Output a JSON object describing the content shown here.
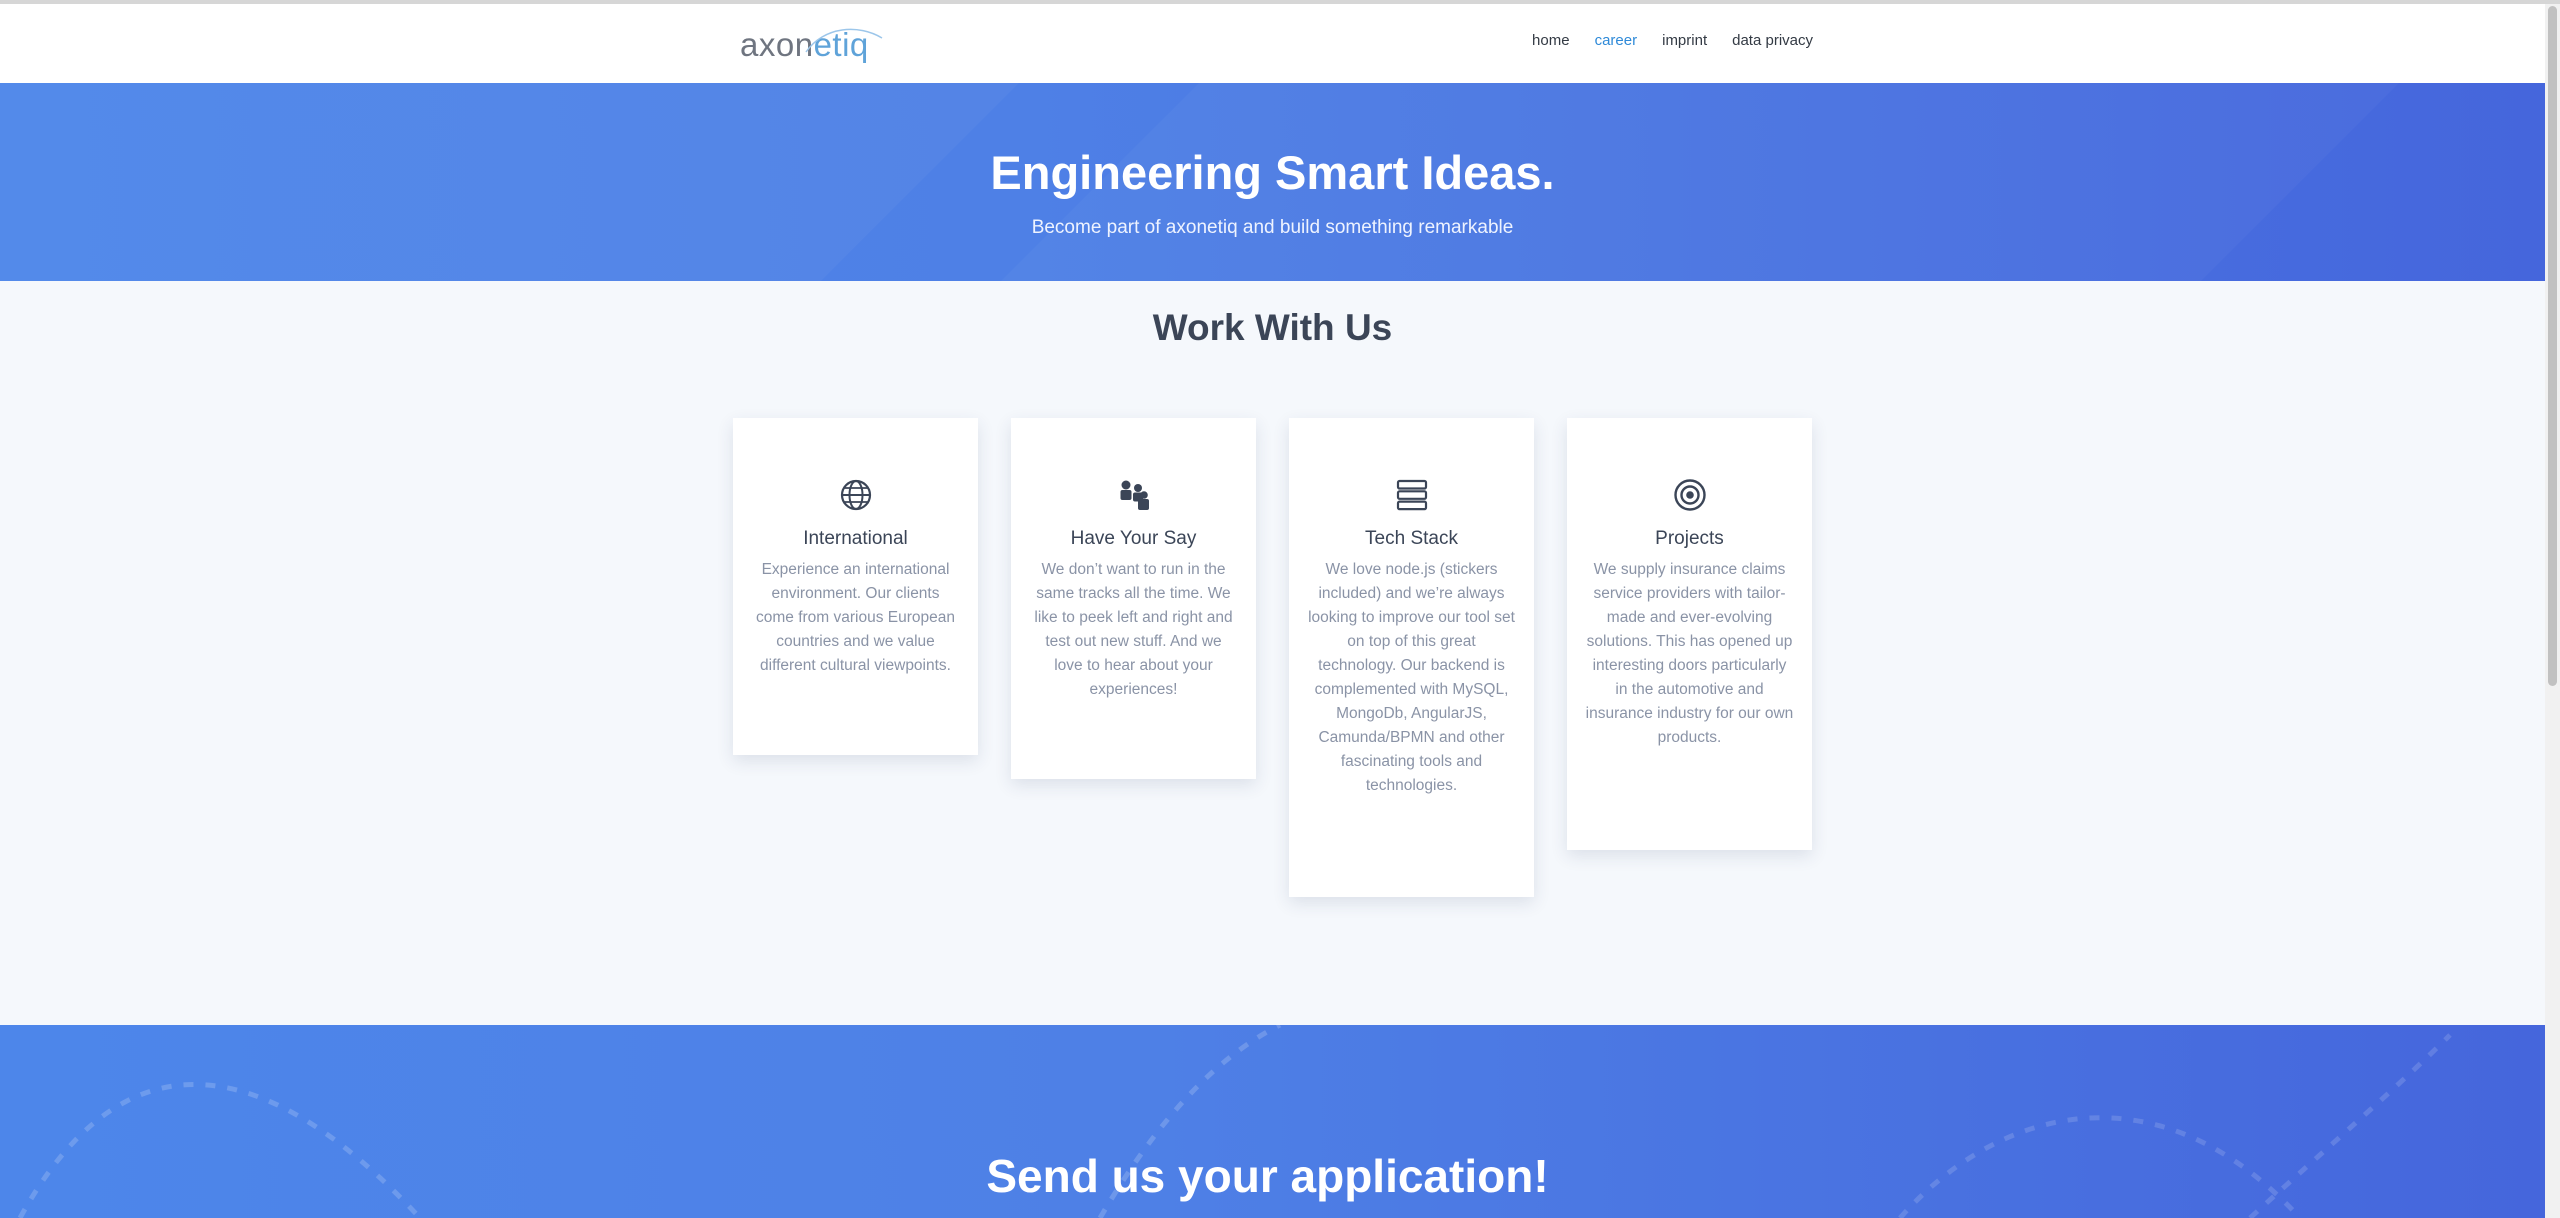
{
  "logo": {
    "part1": "axon",
    "part2": "etiq"
  },
  "nav": {
    "items": [
      {
        "label": "home",
        "active": false
      },
      {
        "label": "career",
        "active": true
      },
      {
        "label": "imprint",
        "active": false
      },
      {
        "label": "data privacy",
        "active": false
      }
    ]
  },
  "hero": {
    "title": "Engineering Smart Ideas.",
    "subtitle": "Become part of axonetiq and build something remarkable"
  },
  "section": {
    "title": "Work With Us"
  },
  "cards": [
    {
      "icon": "globe-icon",
      "title": "International",
      "text": "Experience an international environment. Our clients come from various European countries and we value different cultural viewpoints."
    },
    {
      "icon": "people-icon",
      "title": "Have Your Say",
      "text": "We don’t want to run in the same tracks all the time. We like to peek left and right and test out new stuff. And we love to hear about your experiences!"
    },
    {
      "icon": "server-stack-icon",
      "title": "Tech Stack",
      "text": "We love node.js (stickers included) and we’re always looking to improve our tool set on top of this great technology. Our backend is complemented with MySQL, MongoDb, AngularJS, Camunda/BPMN and other fascinating tools and technologies."
    },
    {
      "icon": "target-icon",
      "title": "Projects",
      "text": "We supply insurance claims service providers with tailor-made and ever-evolving solutions. This has opened up interesting doors particularly in the automotive and insurance industry for our own products."
    }
  ],
  "apply": {
    "title": "Send us your application!"
  },
  "colors": {
    "accent": "#2f8ad8",
    "hero_blue": "#4e80e6",
    "heading": "#3b4557",
    "body_text": "#8a93a6"
  }
}
